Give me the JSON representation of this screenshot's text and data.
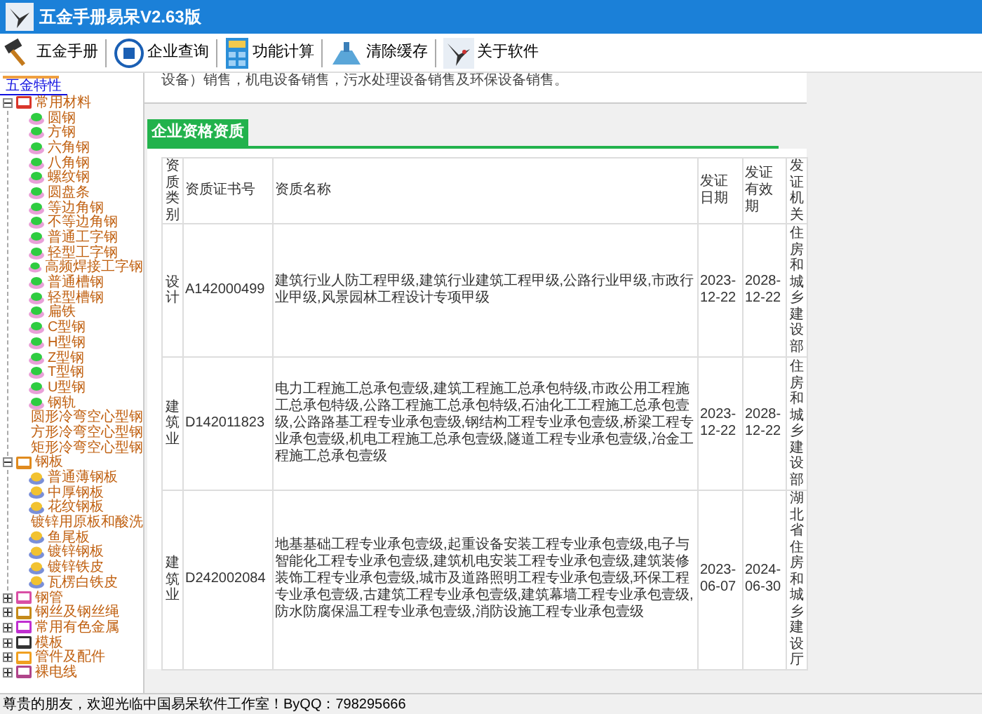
{
  "window": {
    "title": "五金手册易呆V2.63版"
  },
  "toolbar": [
    {
      "label": "五金手册",
      "kind": "hammer"
    },
    {
      "label": "企业查询",
      "kind": "company"
    },
    {
      "label": "功能计算",
      "kind": "calculator"
    },
    {
      "label": "清除缓存",
      "kind": "pipe"
    },
    {
      "label": "关于软件",
      "kind": "bird"
    }
  ],
  "sidebar": {
    "tab": "五金特性",
    "tree": [
      {
        "label": "常用材料",
        "expanded": true,
        "children": [
          {
            "label": "圆钢"
          },
          {
            "label": "方钢"
          },
          {
            "label": "六角钢"
          },
          {
            "label": "八角钢"
          },
          {
            "label": "螺纹钢"
          },
          {
            "label": "圆盘条"
          },
          {
            "label": "等边角钢"
          },
          {
            "label": "不等边角钢"
          },
          {
            "label": "普通工字钢"
          },
          {
            "label": "轻型工字钢"
          },
          {
            "label": "高频焊接工字钢"
          },
          {
            "label": "普通槽钢"
          },
          {
            "label": "轻型槽钢"
          },
          {
            "label": "扁铁"
          },
          {
            "label": "C型钢"
          },
          {
            "label": "H型钢"
          },
          {
            "label": "Z型钢"
          },
          {
            "label": "T型钢"
          },
          {
            "label": "U型钢"
          },
          {
            "label": "钢轨"
          },
          {
            "label": "圆形冷弯空心型钢"
          },
          {
            "label": "方形冷弯空心型钢"
          },
          {
            "label": "矩形冷弯空心型钢"
          }
        ]
      },
      {
        "label": "钢板",
        "expanded": true,
        "children": [
          {
            "label": "普通薄钢板"
          },
          {
            "label": "中厚钢板"
          },
          {
            "label": "花纹钢板"
          },
          {
            "label": "镀锌用原板和酸洗"
          },
          {
            "label": "鱼尾板"
          },
          {
            "label": "镀锌钢板"
          },
          {
            "label": "镀锌铁皮"
          },
          {
            "label": "瓦楞白铁皮"
          }
        ]
      },
      {
        "label": "钢管",
        "expanded": false
      },
      {
        "label": "钢丝及钢丝绳",
        "expanded": false
      },
      {
        "label": "常用有色金属",
        "expanded": false
      },
      {
        "label": "模板",
        "expanded": false
      },
      {
        "label": "管件及配件",
        "expanded": false
      },
      {
        "label": "裸电线",
        "expanded": false
      }
    ]
  },
  "content": {
    "top_text": "设备）销售，机电设备销售，污水处理设备销售及环保设备销售。",
    "tab": "企业资格资质",
    "table": {
      "columns": [
        "资质类别",
        "资质证书号",
        "资质名称",
        "发证日期",
        "发证有效期",
        "发证机关"
      ],
      "rows": [
        [
          "设计",
          "A142000499",
          "建筑行业人防工程甲级,建筑行业建筑工程甲级,公路行业甲级,市政行业甲级,风景园林工程设计专项甲级",
          "2023-12-22",
          "2028-12-22",
          "住房和城乡建设部"
        ],
        [
          "建筑业",
          "D142011823",
          "电力工程施工总承包壹级,建筑工程施工总承包特级,市政公用工程施工总承包特级,公路工程施工总承包特级,石油化工工程施工总承包壹级,公路路基工程专业承包壹级,钢结构工程专业承包壹级,桥梁工程专业承包壹级,机电工程施工总承包壹级,隧道工程专业承包壹级,冶金工程施工总承包壹级",
          "2023-12-22",
          "2028-12-22",
          "住房和城乡建设部"
        ],
        [
          "建筑业",
          "D242002084",
          "地基基础工程专业承包壹级,起重设备安装工程专业承包壹级,电子与智能化工程专业承包壹级,建筑机电安装工程专业承包壹级,建筑装修装饰工程专业承包壹级,城市及道路照明工程专业承包壹级,环保工程专业承包壹级,古建筑工程专业承包壹级,建筑幕墙工程专业承包壹级,防水防腐保温工程专业承包壹级,消防设施工程专业承包壹级",
          "2023-06-07",
          "2024-06-30",
          "湖北省住房和城乡建设厅"
        ]
      ]
    }
  },
  "status_bar": "尊贵的朋友，欢迎光临中国易呆软件工作室！ByQQ：798295666"
}
